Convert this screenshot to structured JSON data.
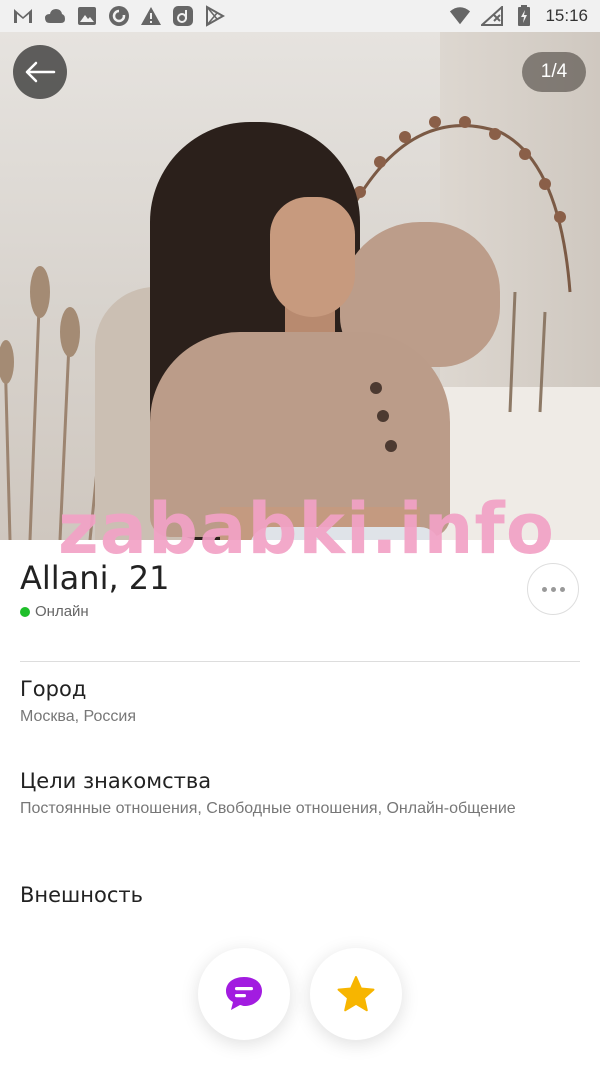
{
  "status_bar": {
    "time": "15:16",
    "left_icons": [
      "gmail-icon",
      "cloud-icon",
      "image-icon",
      "sync-icon",
      "warning-icon",
      "app-icon",
      "play-store-icon"
    ],
    "right_icons": [
      "wifi-icon",
      "no-signal-icon",
      "battery-charging-icon"
    ]
  },
  "photo": {
    "counter": "1/4",
    "back_icon": "arrow-left-icon"
  },
  "watermark": "zababki.info",
  "profile": {
    "name_age": "Allani, 21",
    "status": "Онлайн",
    "status_color": "#1fbf2a"
  },
  "sections": [
    {
      "title": "Город",
      "value": "Москва, Россия"
    },
    {
      "title": "Цели знакомства",
      "value": "Постоянные отношения, Свободные отношения, Онлайн-общение"
    },
    {
      "title": "Внешность",
      "value": ""
    }
  ],
  "actions": {
    "message_icon": "chat-icon",
    "message_color": "#a21ce0",
    "favorite_icon": "star-icon",
    "favorite_color": "#f7b500"
  }
}
